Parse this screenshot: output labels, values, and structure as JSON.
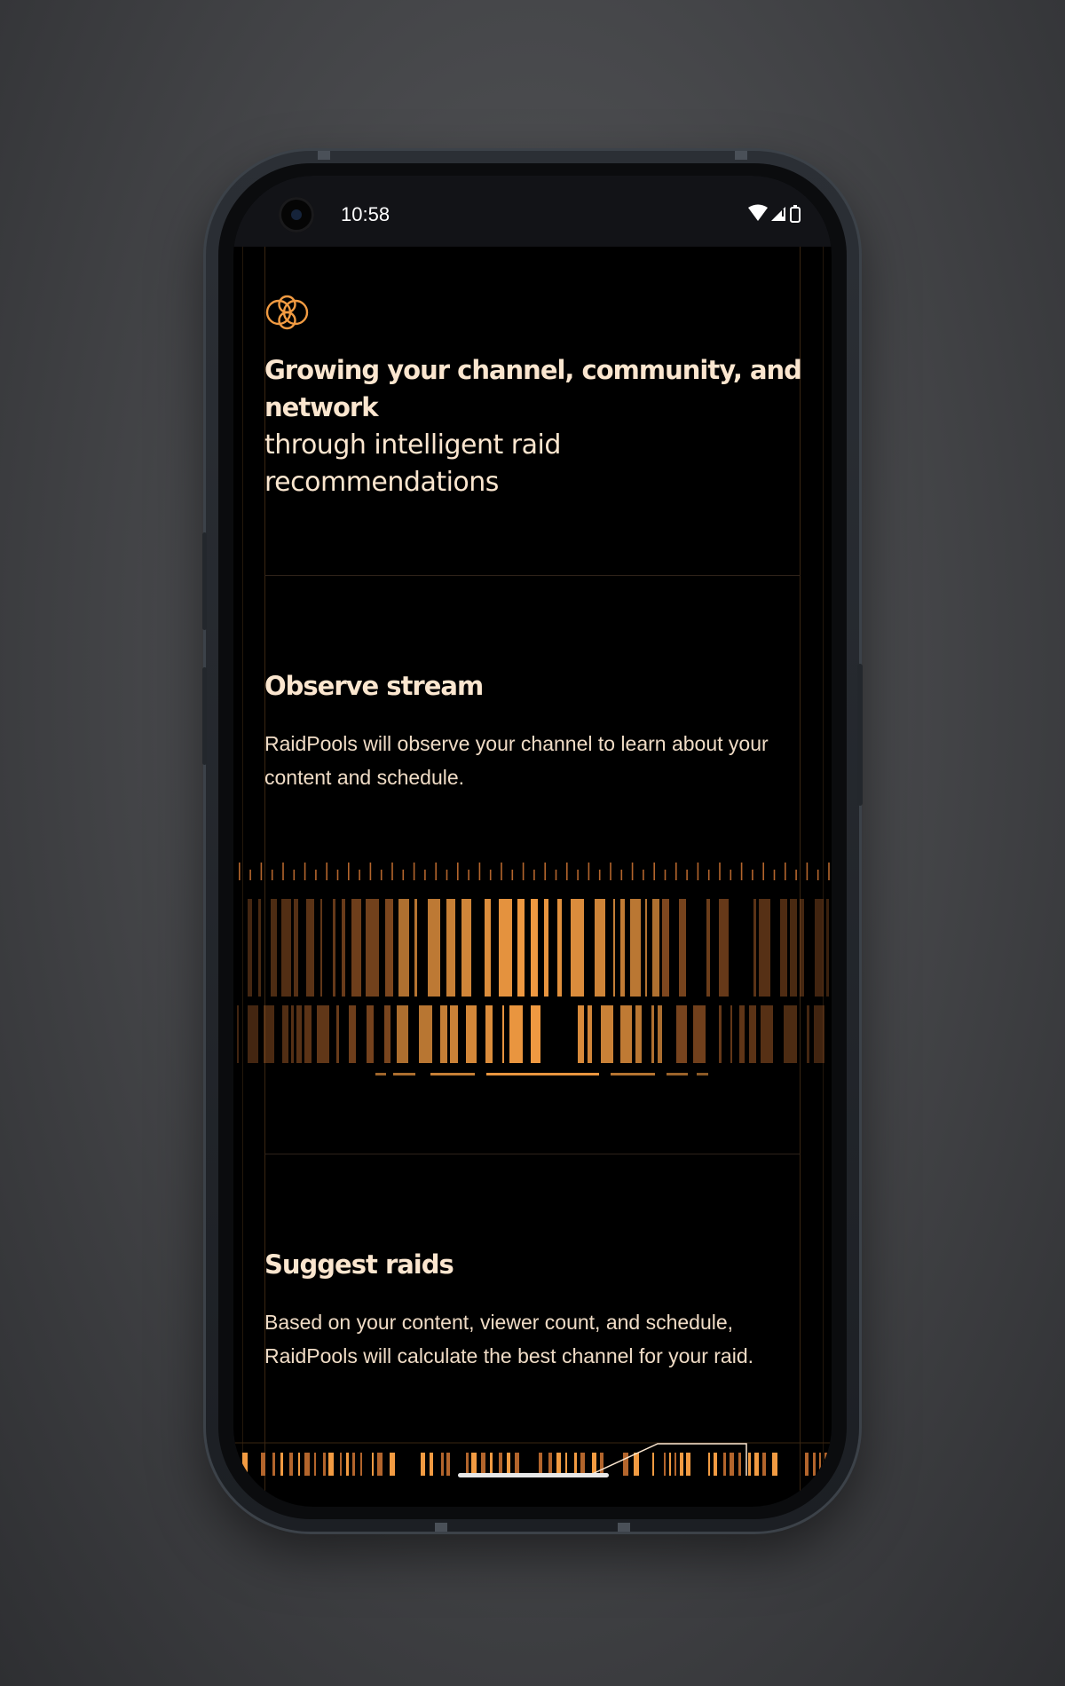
{
  "status_bar": {
    "time": "10:58",
    "icons": [
      "wifi-icon",
      "cellular-signal-icon",
      "battery-icon"
    ]
  },
  "app": {
    "logo_icon": "interlocking-rings-icon",
    "hero": {
      "title": "Growing your channel, community, and network",
      "subtitle": "through intelligent raid recommendations"
    },
    "sections": [
      {
        "title": "Observe stream",
        "body": "RaidPools will observe your channel to learn about your content and schedule."
      },
      {
        "title": "Suggest raids",
        "body": "Based on your content, viewer count, and schedule, RaidPools will calculate the best channel for your raid."
      }
    ]
  },
  "colors": {
    "background": "#000000",
    "text": "#fbe6cf",
    "accent": "#f29b42",
    "accent_dim": "#b3652c",
    "guide_line": "#3a2612"
  }
}
